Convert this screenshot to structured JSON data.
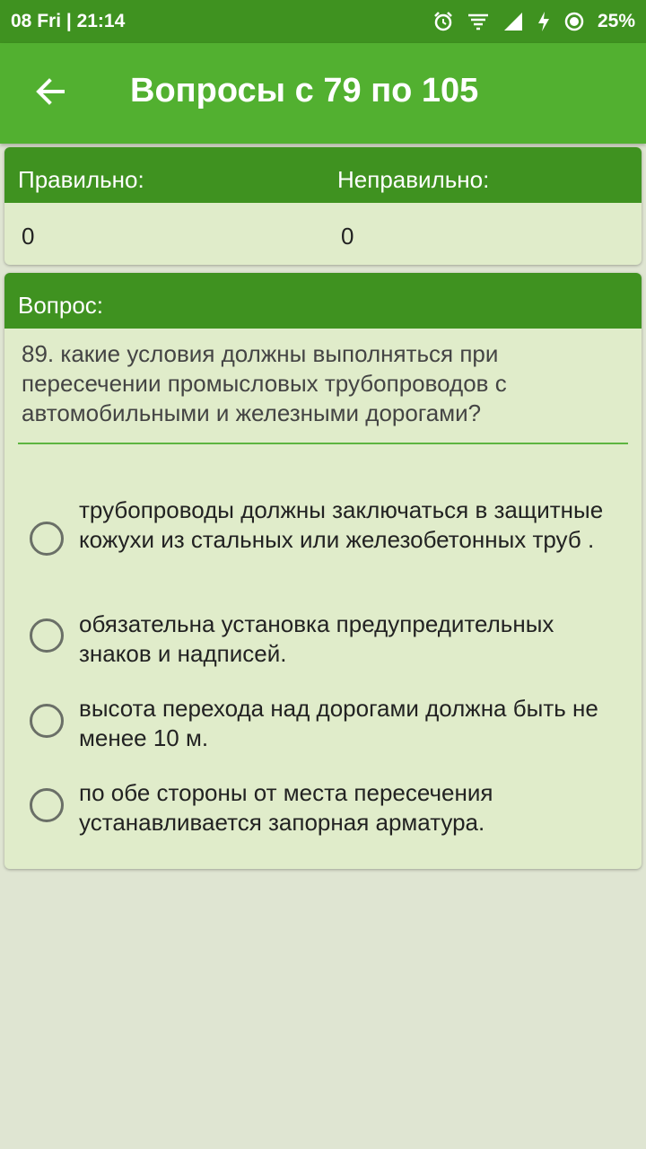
{
  "status_bar": {
    "left": "08 Fri | 21:14",
    "battery": "25%",
    "icons": [
      "alarm-icon",
      "wifi-icon",
      "signal-icon",
      "charging-icon",
      "battery-icon"
    ]
  },
  "app_bar": {
    "title": "Вопросы с 79 по 105",
    "back_icon": "arrow-left-icon"
  },
  "score": {
    "correct_label": "Правильно:",
    "incorrect_label": "Неправильно:",
    "correct_value": "0",
    "incorrect_value": "0"
  },
  "question": {
    "header": "Вопрос:",
    "text": "89. какие условия должны выполняться при пересечении промысловых трубопроводов с автомобильными и железными дорогами?",
    "options": [
      "трубопроводы должны заключаться в защитные кожухи из стальных или железобетонных труб .",
      "обязательна установка предупредительных знаков и надписей.",
      "высота перехода над дорогами должна быть не менее 10 м.",
      "по обе стороны от места пересечения устанавливается запорная арматура."
    ]
  },
  "colors": {
    "status_bar": "#3f9220",
    "app_bar": "#52b030",
    "card_header": "#3f9220",
    "card_body": "#e0ecca",
    "background": "#dfe5d2"
  }
}
